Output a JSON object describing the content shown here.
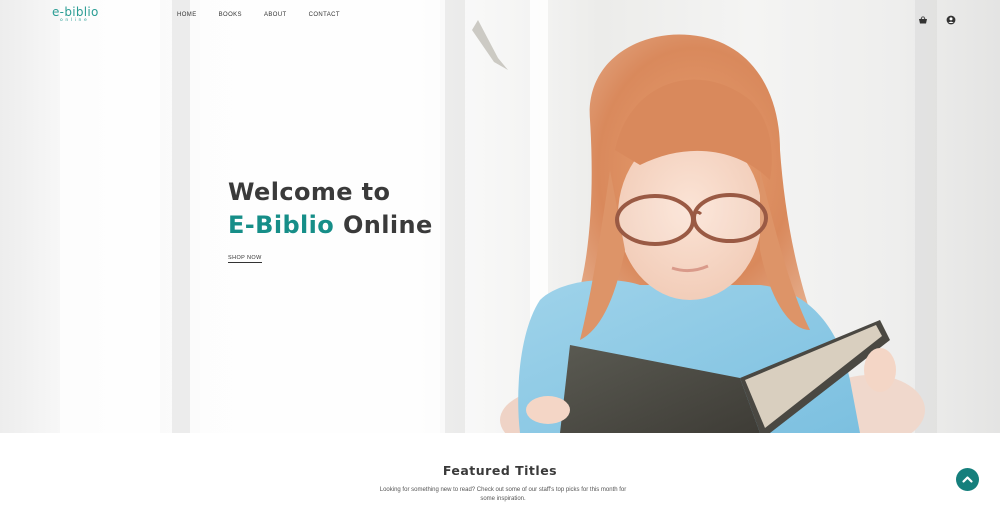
{
  "brand": {
    "logo_main": "e-biblio",
    "logo_sub": "online",
    "accent_color": "#168e88"
  },
  "nav": {
    "items": [
      {
        "label": "HOME"
      },
      {
        "label": "BOOKS"
      },
      {
        "label": "ABOUT"
      },
      {
        "label": "CONTACT"
      }
    ],
    "icons": [
      "basket-icon",
      "user-icon"
    ]
  },
  "hero": {
    "line1": "Welcome to",
    "line2_accent": "E-Biblio",
    "line2_rest": " Online",
    "cta_label": "SHOP NOW",
    "image": "girl-reading-book-photo"
  },
  "featured": {
    "title": "Featured Titles",
    "description": "Looking for something new to read? Check out some of our staff's top picks for this month for some inspiration."
  },
  "scroll_top": {
    "icon": "chevron-up-icon"
  }
}
